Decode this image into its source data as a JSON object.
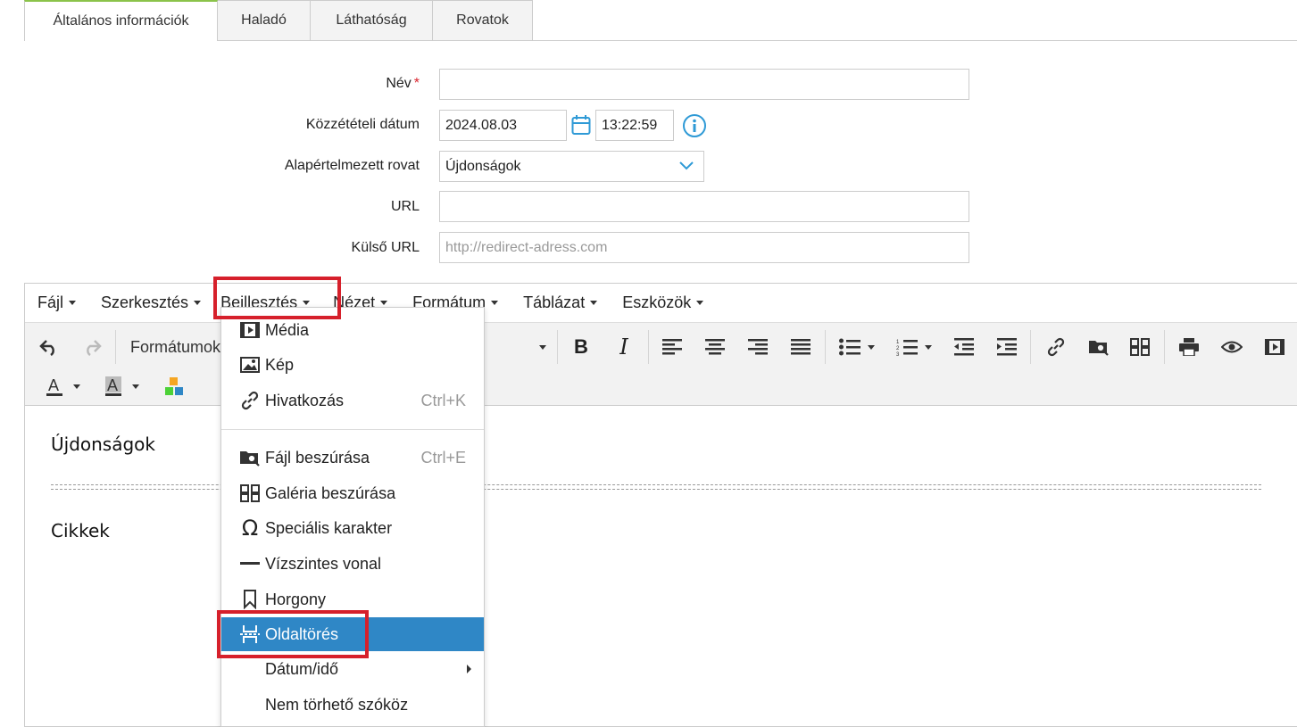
{
  "tabs": [
    {
      "label": "Általános információk"
    },
    {
      "label": "Haladó"
    },
    {
      "label": "Láthatóság"
    },
    {
      "label": "Rovatok"
    }
  ],
  "form": {
    "name_label": "Név",
    "required_mark": "*",
    "name_value": "",
    "pubdate_label": "Közzétételi dátum",
    "date_value": "2024.08.03",
    "time_value": "13:22:59",
    "category_label": "Alapértelmezett rovat",
    "category_value": "Újdonságok",
    "url_label": "URL",
    "url_value": "",
    "external_url_label": "Külső URL",
    "external_url_placeholder": "http://redirect-adress.com"
  },
  "menubar": [
    {
      "label": "Fájl"
    },
    {
      "label": "Szerkesztés"
    },
    {
      "label": "Beillesztés"
    },
    {
      "label": "Nézet"
    },
    {
      "label": "Formátum"
    },
    {
      "label": "Táblázat"
    },
    {
      "label": "Eszközök"
    }
  ],
  "toolbar": {
    "format_select": "Formátumok"
  },
  "content": {
    "heading1": "Újdonságok",
    "heading2": "Cikkek"
  },
  "dropdown": [
    {
      "label": "Média",
      "icon": "media-icon",
      "shortcut": ""
    },
    {
      "label": "Kép",
      "icon": "image-icon",
      "shortcut": ""
    },
    {
      "label": "Hivatkozás",
      "icon": "link-icon",
      "shortcut": "Ctrl+K"
    },
    {
      "label": "Fájl beszúrása",
      "icon": "file-browse-icon",
      "shortcut": "Ctrl+E"
    },
    {
      "label": "Galéria beszúrása",
      "icon": "gallery-icon",
      "shortcut": ""
    },
    {
      "label": "Speciális karakter",
      "icon": "omega-icon",
      "shortcut": ""
    },
    {
      "label": "Vízszintes vonal",
      "icon": "hr-icon",
      "shortcut": ""
    },
    {
      "label": "Horgony",
      "icon": "bookmark-icon",
      "shortcut": ""
    },
    {
      "label": "Oldaltörés",
      "icon": "pagebreak-icon",
      "shortcut": ""
    },
    {
      "label": "Dátum/idő",
      "icon": "",
      "shortcut": ""
    },
    {
      "label": "Nem törhető szóköz",
      "icon": "",
      "shortcut": ""
    }
  ],
  "colors": {
    "accent": "#2f87c6",
    "highlight": "#d6202b",
    "tab_active_border": "#8bc34a",
    "required": "#d9232d"
  }
}
